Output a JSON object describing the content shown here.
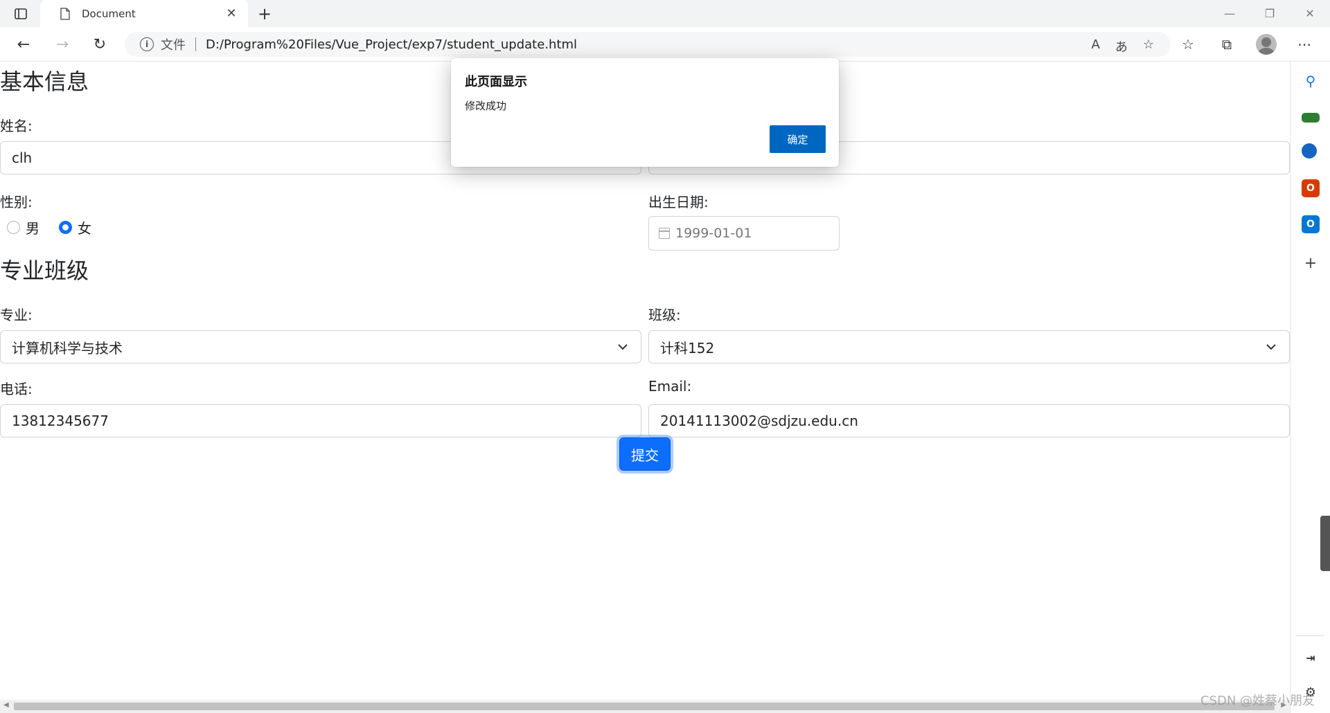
{
  "browser": {
    "tab_title": "Document",
    "address_scheme_label": "文件",
    "url": "D:/Program%20Files/Vue_Project/exp7/student_update.html"
  },
  "form": {
    "basic_section_title": "基本信息",
    "name_label": "姓名:",
    "name_value": "clh",
    "gender_label": "性别:",
    "gender_options": [
      "男",
      "女"
    ],
    "gender_selected": "女",
    "birth_label": "出生日期:",
    "birth_value": "1999-01-01",
    "major_section_title": "专业班级",
    "major_label": "专业:",
    "major_value": "计算机科学与技术",
    "class_label": "班级:",
    "class_value": "计科152",
    "phone_label": "电话:",
    "phone_value": "13812345677",
    "email_label": "Email:",
    "email_value": "20141113002@sdjzu.edu.cn",
    "submit_label": "提交"
  },
  "dialog": {
    "title": "此页面显示",
    "message": "修改成功",
    "ok_label": "确定"
  },
  "watermark": "CSDN @姓蔡小朋友",
  "colors": {
    "primary": "#0d6efd",
    "dialog_button": "#0067c0"
  }
}
